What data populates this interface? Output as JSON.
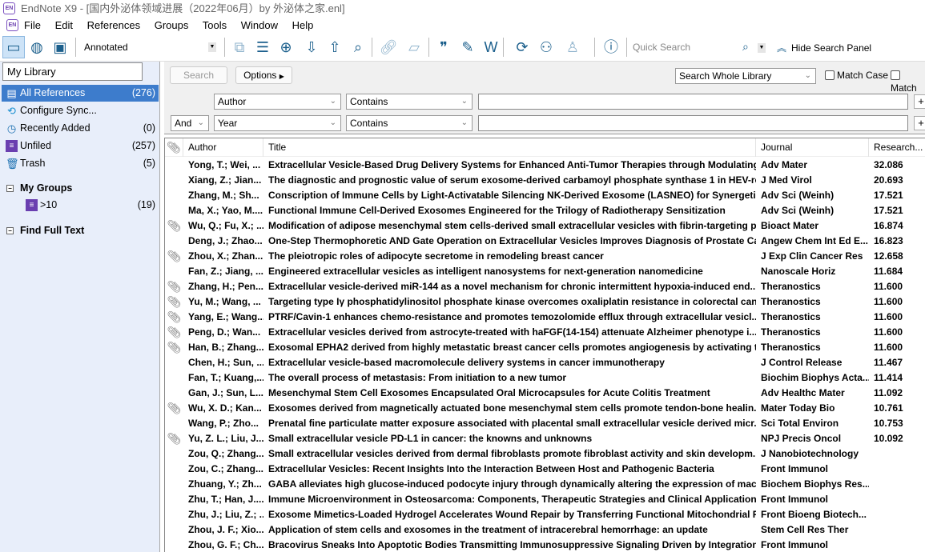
{
  "window": {
    "title": "EndNote X9 - [国内外泌体领域进展（2022年06月）by 外泌体之家.enl]",
    "logo_text": "EN"
  },
  "menu": [
    "File",
    "Edit",
    "References",
    "Groups",
    "Tools",
    "Window",
    "Help"
  ],
  "toolbar": {
    "style": "Annotated",
    "quick_search_placeholder": "Quick Search",
    "hide_search_panel": "Hide Search Panel"
  },
  "sidebar": {
    "library_select": "My Library",
    "items": [
      {
        "label": "All References",
        "count": "(276)",
        "icon": "all-references-icon"
      },
      {
        "label": "Configure Sync...",
        "count": "",
        "icon": "sync-icon"
      },
      {
        "label": "Recently Added",
        "count": "(0)",
        "icon": "clock-icon"
      },
      {
        "label": "Unfiled",
        "count": "(257)",
        "icon": "unfiled-icon"
      },
      {
        "label": "Trash",
        "count": "(5)",
        "icon": "trash-icon"
      }
    ],
    "my_groups": "My Groups",
    "groups": [
      {
        "label": ">10",
        "count": "(19)"
      }
    ],
    "find_full_text": "Find Full Text"
  },
  "search": {
    "search_button": "Search",
    "options_button": "Options",
    "scope": "Search Whole Library",
    "match_case": "Match Case",
    "match_words": "Match",
    "rows": [
      {
        "bool": "",
        "field": "Author",
        "op": "Contains",
        "value": ""
      },
      {
        "bool": "And",
        "field": "Year",
        "op": "Contains",
        "value": ""
      }
    ]
  },
  "table": {
    "columns": [
      "Author",
      "Title",
      "Journal",
      "Research..."
    ],
    "rows": [
      {
        "a": false,
        "author": "Yong, T.; Wei, ...",
        "title": "Extracellular Vesicle-Based Drug Delivery Systems for Enhanced Anti-Tumor Therapies through Modulating...",
        "journal": "Adv Mater",
        "impact": "32.086"
      },
      {
        "a": false,
        "author": "Xiang, Z.; Jian...",
        "title": "The diagnostic and prognostic value of serum exosome-derived carbamoyl phosphate synthase 1 in HEV-rel...",
        "journal": "J Med Virol",
        "impact": "20.693"
      },
      {
        "a": false,
        "author": "Zhang, M.; Sh...",
        "title": "Conscription of Immune Cells by Light-Activatable Silencing NK-Derived Exosome (LASNEO) for Synergetic ...",
        "journal": "Adv Sci (Weinh)",
        "impact": "17.521"
      },
      {
        "a": false,
        "author": "Ma, X.; Yao, M....",
        "title": "Functional Immune Cell-Derived Exosomes Engineered for the Trilogy of Radiotherapy Sensitization",
        "journal": "Adv Sci (Weinh)",
        "impact": "17.521"
      },
      {
        "a": true,
        "author": "Wu, Q.; Fu, X.; ...",
        "title": "Modification of adipose mesenchymal stem cells-derived small extracellular vesicles with fibrin-targeting p...",
        "journal": "Bioact Mater",
        "impact": "16.874"
      },
      {
        "a": false,
        "author": "Deng, J.; Zhao...",
        "title": "One-Step Thermophoretic AND Gate Operation on Extracellular Vesicles Improves Diagnosis of Prostate Ca...",
        "journal": "Angew Chem Int Ed E...",
        "impact": "16.823"
      },
      {
        "a": true,
        "author": "Zhou, X.; Zhan...",
        "title": "The pleiotropic roles of adipocyte secretome in remodeling breast cancer",
        "journal": "J Exp Clin Cancer Res",
        "impact": "12.658"
      },
      {
        "a": false,
        "author": "Fan, Z.; Jiang, ...",
        "title": "Engineered extracellular vesicles as intelligent nanosystems for next-generation nanomedicine",
        "journal": "Nanoscale Horiz",
        "impact": "11.684"
      },
      {
        "a": true,
        "author": "Zhang, H.; Pen...",
        "title": "Extracellular vesicle-derived miR-144 as a novel mechanism for chronic intermittent hypoxia-induced end...",
        "journal": "Theranostics",
        "impact": "11.600"
      },
      {
        "a": true,
        "author": "Yu, M.; Wang, ...",
        "title": "Targeting type Iγ phosphatidylinositol phosphate kinase overcomes oxaliplatin resistance in colorectal cancer",
        "journal": "Theranostics",
        "impact": "11.600"
      },
      {
        "a": true,
        "author": "Yang, E.; Wang...",
        "title": "PTRF/Cavin-1 enhances chemo-resistance and promotes temozolomide efflux through extracellular vesicl...",
        "journal": "Theranostics",
        "impact": "11.600"
      },
      {
        "a": true,
        "author": "Peng, D.; Wan...",
        "title": "Extracellular vesicles derived from astrocyte-treated with haFGF(14-154) attenuate Alzheimer phenotype i...",
        "journal": "Theranostics",
        "impact": "11.600"
      },
      {
        "a": true,
        "author": "Han, B.; Zhang...",
        "title": "Exosomal EPHA2 derived from highly metastatic breast cancer cells promotes angiogenesis by activating th...",
        "journal": "Theranostics",
        "impact": "11.600"
      },
      {
        "a": false,
        "author": "Chen, H.; Sun, ...",
        "title": "Extracellular vesicle-based macromolecule delivery systems in cancer immunotherapy",
        "journal": "J Control Release",
        "impact": "11.467"
      },
      {
        "a": false,
        "author": "Fan, T.; Kuang,...",
        "title": "The overall process of metastasis: From initiation to a new tumor",
        "journal": "Biochim Biophys Acta...",
        "impact": "11.414"
      },
      {
        "a": false,
        "author": "Gan, J.; Sun, L....",
        "title": "Mesenchymal Stem Cell Exosomes Encapsulated Oral Microcapsules for Acute Colitis Treatment",
        "journal": "Adv Healthc Mater",
        "impact": "11.092"
      },
      {
        "a": true,
        "author": "Wu, X. D.; Kan...",
        "title": "Exosomes derived from magnetically actuated bone mesenchymal stem cells promote tendon-bone healin...",
        "journal": "Mater Today Bio",
        "impact": "10.761"
      },
      {
        "a": false,
        "author": "Wang, P.; Zho...",
        "title": "Prenatal fine particulate matter exposure associated with placental small extracellular vesicle derived micr...",
        "journal": "Sci Total Environ",
        "impact": "10.753"
      },
      {
        "a": true,
        "author": "Yu, Z. L.; Liu, J....",
        "title": "Small extracellular vesicle PD-L1 in cancer: the knowns and unknowns",
        "journal": "NPJ Precis Oncol",
        "impact": "10.092"
      },
      {
        "a": false,
        "author": "Zou, Q.; Zhang...",
        "title": "Small extracellular vesicles derived from dermal fibroblasts promote fibroblast activity and skin developm...",
        "journal": "J Nanobiotechnology",
        "impact": ""
      },
      {
        "a": false,
        "author": "Zou, C.; Zhang...",
        "title": "Extracellular Vesicles: Recent Insights Into the Interaction Between Host and Pathogenic Bacteria",
        "journal": "Front Immunol",
        "impact": ""
      },
      {
        "a": false,
        "author": "Zhuang, Y.; Zh...",
        "title": "GABA alleviates high glucose-induced podocyte injury through dynamically altering the expression of macr...",
        "journal": "Biochem Biophys Res...",
        "impact": ""
      },
      {
        "a": false,
        "author": "Zhu, T.; Han, J....",
        "title": "Immune Microenvironment in Osteosarcoma: Components, Therapeutic Strategies and Clinical Applications",
        "journal": "Front Immunol",
        "impact": ""
      },
      {
        "a": false,
        "author": "Zhu, J.; Liu, Z.; ...",
        "title": "Exosome Mimetics-Loaded Hydrogel Accelerates Wound Repair by Transferring Functional Mitochondrial P...",
        "journal": "Front Bioeng Biotech...",
        "impact": ""
      },
      {
        "a": false,
        "author": "Zhou, J. F.; Xio...",
        "title": "Application of stem cells and exosomes in the treatment of intracerebral hemorrhage: an update",
        "journal": "Stem Cell Res Ther",
        "impact": ""
      },
      {
        "a": false,
        "author": "Zhou, G. F.; Ch...",
        "title": "Bracovirus Sneaks Into Apoptotic Bodies Transmitting Immunosuppressive Signaling Driven by Integration-...",
        "journal": "Front Immunol",
        "impact": ""
      }
    ]
  },
  "colors": {
    "selection": "#3d7ccc",
    "sidebar_bg": "#e8eefa",
    "icon_blue": "#1b5f8c"
  }
}
